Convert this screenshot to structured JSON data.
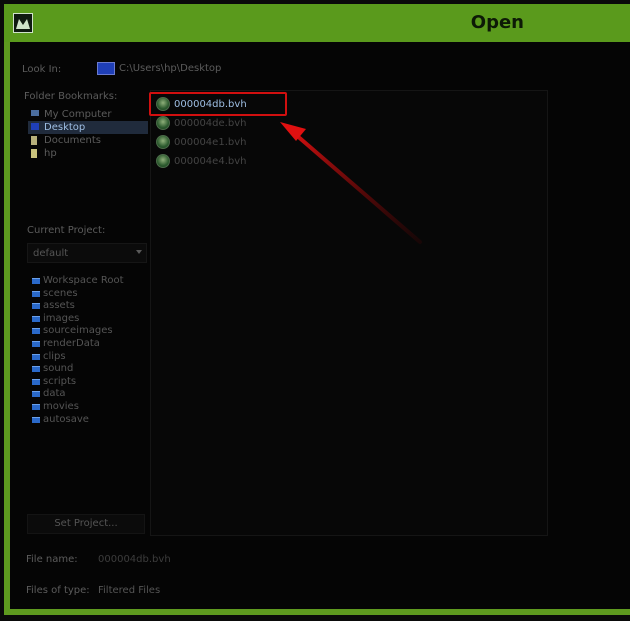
{
  "window": {
    "title": "Open",
    "accent_color": "#5e9a1f"
  },
  "look_in": {
    "label": "Look In:",
    "path": "C:\\Users\\hp\\Desktop"
  },
  "bookmarks": {
    "label": "Folder Bookmarks:",
    "items": [
      {
        "label": "My Computer",
        "icon": "computer-icon"
      },
      {
        "label": "Desktop",
        "icon": "desktop-icon",
        "selected": true
      },
      {
        "label": "Documents",
        "icon": "documents-icon"
      },
      {
        "label": "hp",
        "icon": "user-folder-icon"
      }
    ]
  },
  "files": [
    {
      "name": "000004db.bvh",
      "selected": true
    },
    {
      "name": "000004de.bvh"
    },
    {
      "name": "000004e1.bvh"
    },
    {
      "name": "000004e4.bvh"
    }
  ],
  "project": {
    "label": "Current Project:",
    "selected": "default",
    "folders": [
      "Workspace Root",
      "scenes",
      "assets",
      "images",
      "sourceimages",
      "renderData",
      "clips",
      "sound",
      "scripts",
      "data",
      "movies",
      "autosave"
    ],
    "set_button": "Set Project..."
  },
  "file_name": {
    "label": "File name:",
    "value": "000004db.bvh"
  },
  "file_type": {
    "label": "Files of type:",
    "value": "Filtered Files"
  },
  "annotation": {
    "color": "#d10f0f"
  }
}
